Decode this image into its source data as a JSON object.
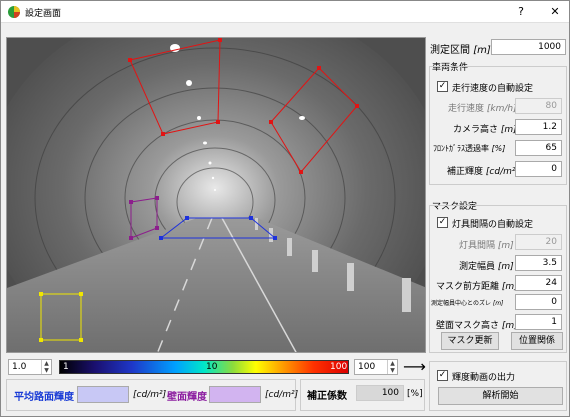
{
  "window": {
    "title": "設定画面",
    "help_label": "?",
    "close_label": "✕"
  },
  "right": {
    "measure_interval_label": "測定区間",
    "measure_interval_unit": "[m]",
    "measure_interval_value": "1000",
    "vehicle_group_title": "車両条件",
    "auto_speed_label": "走行速度の自動設定",
    "speed_label": "走行速度",
    "speed_unit": "[km/h]",
    "speed_value": "80",
    "camera_height_label": "カメラ高さ",
    "camera_height_unit": "[m]",
    "camera_height_value": "1.2",
    "glass_trans_label": "ﾌﾛﾝﾄｶﾞﾗｽ透過率",
    "glass_trans_unit": "[%]",
    "glass_trans_value": "65",
    "corr_lum_label": "補正輝度",
    "corr_lum_unit": "[cd/m²]",
    "corr_lum_value": "0",
    "mask_group_title": "マスク設定",
    "auto_light_label": "灯具間隔の自動設定",
    "light_interval_label": "灯具間隔",
    "light_interval_unit": "[m]",
    "light_interval_value": "20",
    "measure_width_label": "測定幅員",
    "measure_width_unit": "[m]",
    "measure_width_value": "3.5",
    "mask_front_label": "マスク前方距離",
    "mask_front_unit": "[m]",
    "mask_front_value": "24",
    "offset_label": "測定幅員中心とのズレ",
    "offset_unit": "[m]",
    "offset_value": "0",
    "wall_mask_label": "壁面マスク高さ",
    "wall_mask_unit": "[m]",
    "wall_mask_value": "1",
    "mask_update_btn": "マスク更新",
    "position_btn": "位置関係",
    "output_video_label": "輝度動画の出力",
    "start_analysis_btn": "解析開始"
  },
  "colorbar": {
    "min_spin": "1.0",
    "max_spin": "100",
    "label_min": "1",
    "label_mid": "10",
    "label_max": "100",
    "arrow": "⟶"
  },
  "bottom": {
    "road_lum_label": "平均路面輝度",
    "road_lum_unit": "[cd/m²]",
    "wall_lum_label": "壁面輝度",
    "wall_lum_unit": "[cd/m²]",
    "corr_coef_label": "補正係数",
    "corr_coef_value": "100",
    "corr_coef_unit": "[%]"
  },
  "colors": {
    "road_swatch": "#c8c8f5",
    "wall_swatch": "#d2b4f0",
    "mask_red": "#e11414",
    "mask_blue": "#1e32dc",
    "mask_purple": "#8c1e8c",
    "mask_yellow": "#f0e600"
  }
}
